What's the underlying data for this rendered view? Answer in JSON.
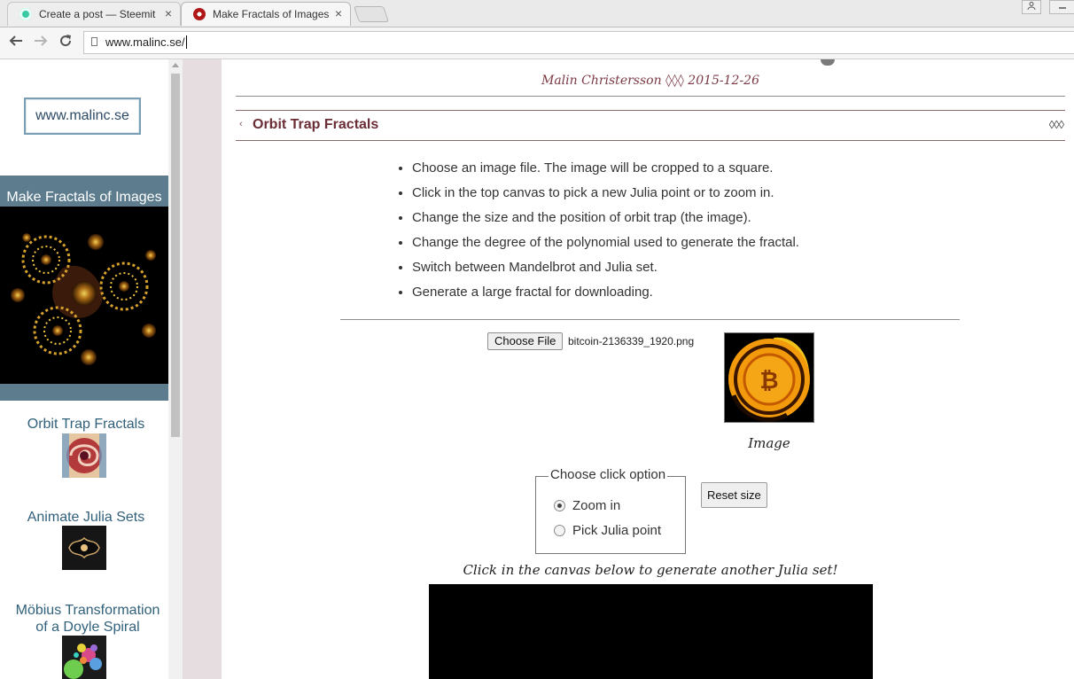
{
  "browser": {
    "tabs": [
      {
        "title": "Create a post — Steemit",
        "close": "×"
      },
      {
        "title": "Make Fractals of Images",
        "close": "×"
      }
    ],
    "url": "www.malinc.se/"
  },
  "sidebar": {
    "site_link": "www.malinc.se",
    "active_item": "Make Fractals of Images",
    "items": [
      {
        "label": "Orbit Trap Fractals"
      },
      {
        "label": "Animate Julia Sets"
      },
      {
        "label": "Möbius Transformation of a Doyle Spiral"
      }
    ]
  },
  "article": {
    "author": "Malin Christersson",
    "separator": "◊◊◊",
    "date": "2015-12-26",
    "section_arrow": "‹",
    "section_title": "Orbit Trap Fractals",
    "section_mark": "◊◊◊",
    "instructions": [
      "Choose an image file. The image will be cropped to a square.",
      "Click in the top canvas to pick a new Julia point or to zoom in.",
      "Change the size and the position of orbit trap (the image).",
      "Change the degree of the polynomial used to generate the fractal.",
      "Switch between Mandelbrot and Julia set.",
      "Generate a large fractal for downloading."
    ],
    "choose_file_label": "Choose File",
    "file_name": "bitcoin-2136339_1920.png",
    "image_caption": "Image",
    "click_option": {
      "legend": "Choose click option",
      "options": [
        {
          "label": "Zoom in",
          "selected": true
        },
        {
          "label": "Pick Julia point",
          "selected": false
        }
      ]
    },
    "reset_label": "Reset size",
    "canvas_note": "Click in the canvas below to generate another Julia set!"
  },
  "colors": {
    "sidebar_active": "#5d7d8f",
    "sidebar_link": "#31607a",
    "heading": "#6b2d35",
    "gutter": "#e5dde0"
  }
}
